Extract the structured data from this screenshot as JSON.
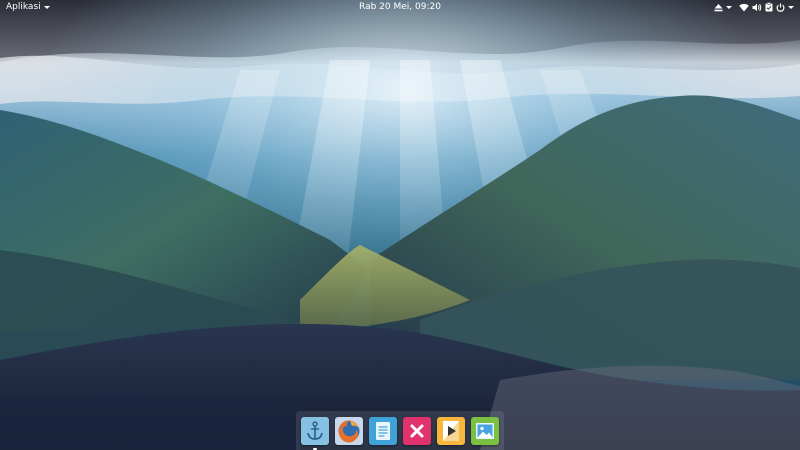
{
  "panel": {
    "apps_menu_label": "Aplikasi",
    "clock": "Rab 20 Mei, 09:20",
    "indicators": [
      "eject-icon",
      "wifi-icon",
      "volume-icon",
      "clipboard-icon",
      "power-icon"
    ]
  },
  "dock": {
    "items": [
      {
        "name": "anchor-icon",
        "color": "#7fbfe6",
        "running": true
      },
      {
        "name": "firefox-icon",
        "color": "#e8702a",
        "running": false
      },
      {
        "name": "document-icon",
        "color": "#3fa3d8",
        "running": false
      },
      {
        "name": "close-x-icon",
        "color": "#e0336e",
        "running": false
      },
      {
        "name": "media-player-icon",
        "color": "#f6b73c",
        "running": false
      },
      {
        "name": "image-viewer-icon",
        "color": "#7bc043",
        "running": false
      }
    ]
  }
}
